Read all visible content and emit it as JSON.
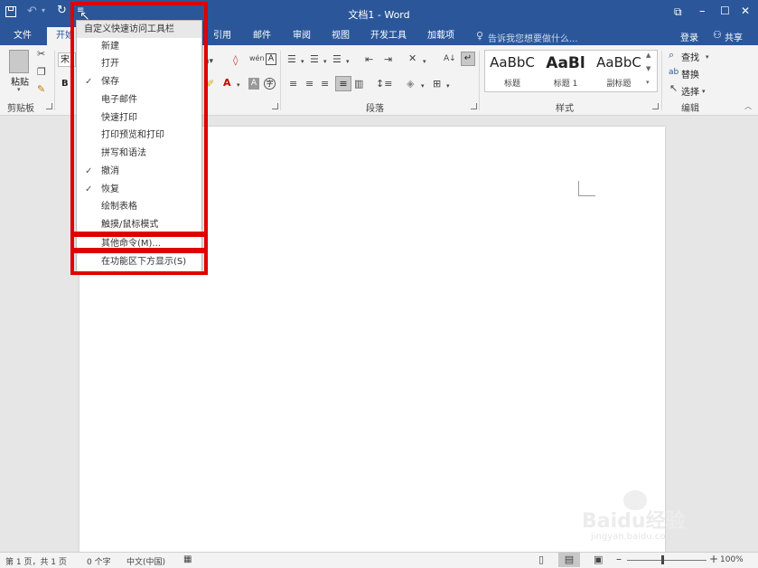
{
  "window": {
    "title": "文档1 - Word",
    "controls": {
      "ribbon_options": "⧉",
      "minimize": "–",
      "maximize": "☐",
      "close": "✕"
    }
  },
  "qat": {
    "save_icon": "save-icon",
    "undo_icon": "undo-icon",
    "redo_icon": "redo-icon",
    "customize_icon": "customize-qat-icon"
  },
  "tabs": [
    {
      "label": "文件"
    },
    {
      "label": "开始"
    },
    {
      "label": "引用"
    },
    {
      "label": "邮件"
    },
    {
      "label": "审阅"
    },
    {
      "label": "视图"
    },
    {
      "label": "开发工具"
    },
    {
      "label": "加载项"
    }
  ],
  "tell_me": "告诉我您想要做什么...",
  "signin": "登录",
  "share": "共享",
  "ribbon": {
    "clipboard": {
      "paste": "粘贴",
      "label": "剪贴板"
    },
    "font": {
      "name_partial": "宋",
      "bold": "B"
    },
    "paragraph": {
      "label": "段落"
    },
    "styles": {
      "label": "样式",
      "items": [
        {
          "preview": "AaBbC",
          "name": "标题"
        },
        {
          "preview": "AaBl",
          "name": "标题 1"
        },
        {
          "preview": "AaBbC",
          "name": "副标题"
        }
      ]
    },
    "editing": {
      "find": "查找",
      "replace": "替换",
      "select": "选择",
      "label": "编辑"
    }
  },
  "menu": {
    "header": "自定义快速访问工具栏",
    "items": [
      {
        "label": "新建",
        "checked": false
      },
      {
        "label": "打开",
        "checked": false
      },
      {
        "label": "保存",
        "checked": true
      },
      {
        "label": "电子邮件",
        "checked": false
      },
      {
        "label": "快速打印",
        "checked": false
      },
      {
        "label": "打印预览和打印",
        "checked": false
      },
      {
        "label": "拼写和语法",
        "checked": false
      },
      {
        "label": "撤消",
        "checked": true
      },
      {
        "label": "恢复",
        "checked": true
      },
      {
        "label": "绘制表格",
        "checked": false
      },
      {
        "label": "触摸/鼠标模式",
        "checked": false
      }
    ],
    "more_commands": "其他命令(M)...",
    "show_below": "在功能区下方显示(S)",
    "check_glyph": "✓"
  },
  "status": {
    "page": "第 1 页，共 1 页",
    "words": "0 个字",
    "language": "中文(中国)",
    "zoom": "100%"
  },
  "watermark": {
    "brand": "Baidu经验",
    "url": "jingyan.baidu.com"
  },
  "colors": {
    "title_blue": "#2b579a",
    "highlight_red": "#e00000"
  }
}
